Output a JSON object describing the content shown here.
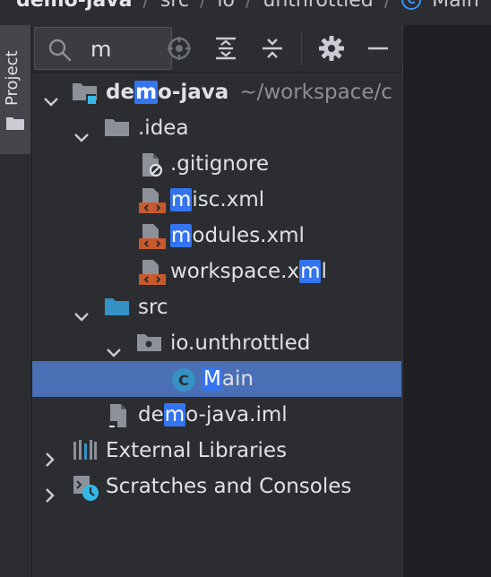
{
  "breadcrumb": {
    "items": [
      "demo-java",
      "src",
      "io",
      "unthrottled",
      "Main"
    ],
    "class_icon_letter": "C"
  },
  "stripe": {
    "project_label": "Project"
  },
  "toolbar": {
    "search_value": "m",
    "icons": [
      "search-icon",
      "locate-icon",
      "expand-all-icon",
      "collapse-all-icon",
      "gear-icon",
      "minimize-icon"
    ]
  },
  "tree": {
    "root": {
      "pre": "de",
      "match": "m",
      "post": "o-java",
      "path": "~/workspace/c"
    },
    "idea": {
      "label": ".idea"
    },
    "gitignore": {
      "label": ".gitignore"
    },
    "misc": {
      "pre": "",
      "match": "m",
      "post": "isc.xml"
    },
    "modules": {
      "pre": "",
      "match": "m",
      "post": "odules.xml"
    },
    "workspace": {
      "pre": "workspace.x",
      "match": "m",
      "post": "l"
    },
    "src": {
      "label": "src"
    },
    "package": {
      "label": "io.unthrottled"
    },
    "main": {
      "pre": "",
      "match": "M",
      "post": "ain",
      "icon_letter": "C"
    },
    "iml": {
      "pre": "de",
      "match": "m",
      "post": "o-java.iml"
    },
    "external": {
      "label": "External Libraries"
    },
    "scratches": {
      "label": "Scratches and Consoles"
    }
  },
  "colors": {
    "background": "#2b2d30",
    "selection": "#4a6fb5",
    "match_highlight": "#3574f0",
    "folder": "#8c9199",
    "source_folder": "#3592c4",
    "xml_badge": "#c65a2e",
    "class_icon": "#3592c4"
  }
}
